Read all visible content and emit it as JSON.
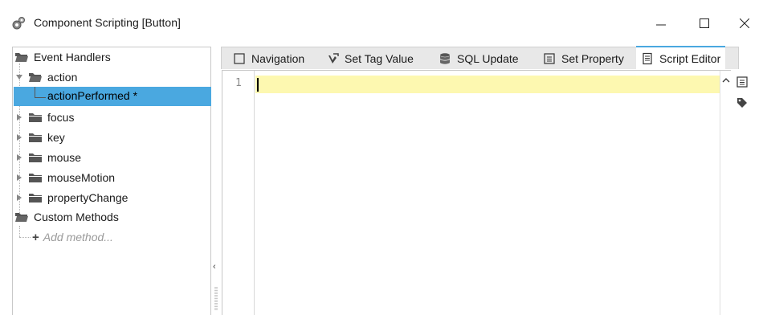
{
  "window": {
    "title": "Component Scripting [Button]",
    "minimize_glyph": "—",
    "maximize_glyph": "☐",
    "close_glyph": "✕"
  },
  "tree": {
    "event_handlers": "Event Handlers",
    "action": "action",
    "action_performed": "actionPerformed *",
    "focus": "focus",
    "key": "key",
    "mouse": "mouse",
    "mouse_motion": "mouseMotion",
    "property_change": "propertyChange",
    "custom_methods": "Custom Methods",
    "add_method": "Add method..."
  },
  "tabs": [
    {
      "label": "Navigation",
      "icon": "checkbox-icon"
    },
    {
      "label": "Set Tag Value",
      "icon": "tag-check-icon"
    },
    {
      "label": "SQL Update",
      "icon": "database-icon"
    },
    {
      "label": "Set Property",
      "icon": "list-icon"
    },
    {
      "label": "Script Editor",
      "icon": "script-icon"
    }
  ],
  "editor": {
    "line_numbers": [
      "1"
    ]
  },
  "colors": {
    "selection": "#4aa8e0",
    "current_line": "#fdf8b0",
    "active_tab_accent": "#4aa8e0"
  }
}
